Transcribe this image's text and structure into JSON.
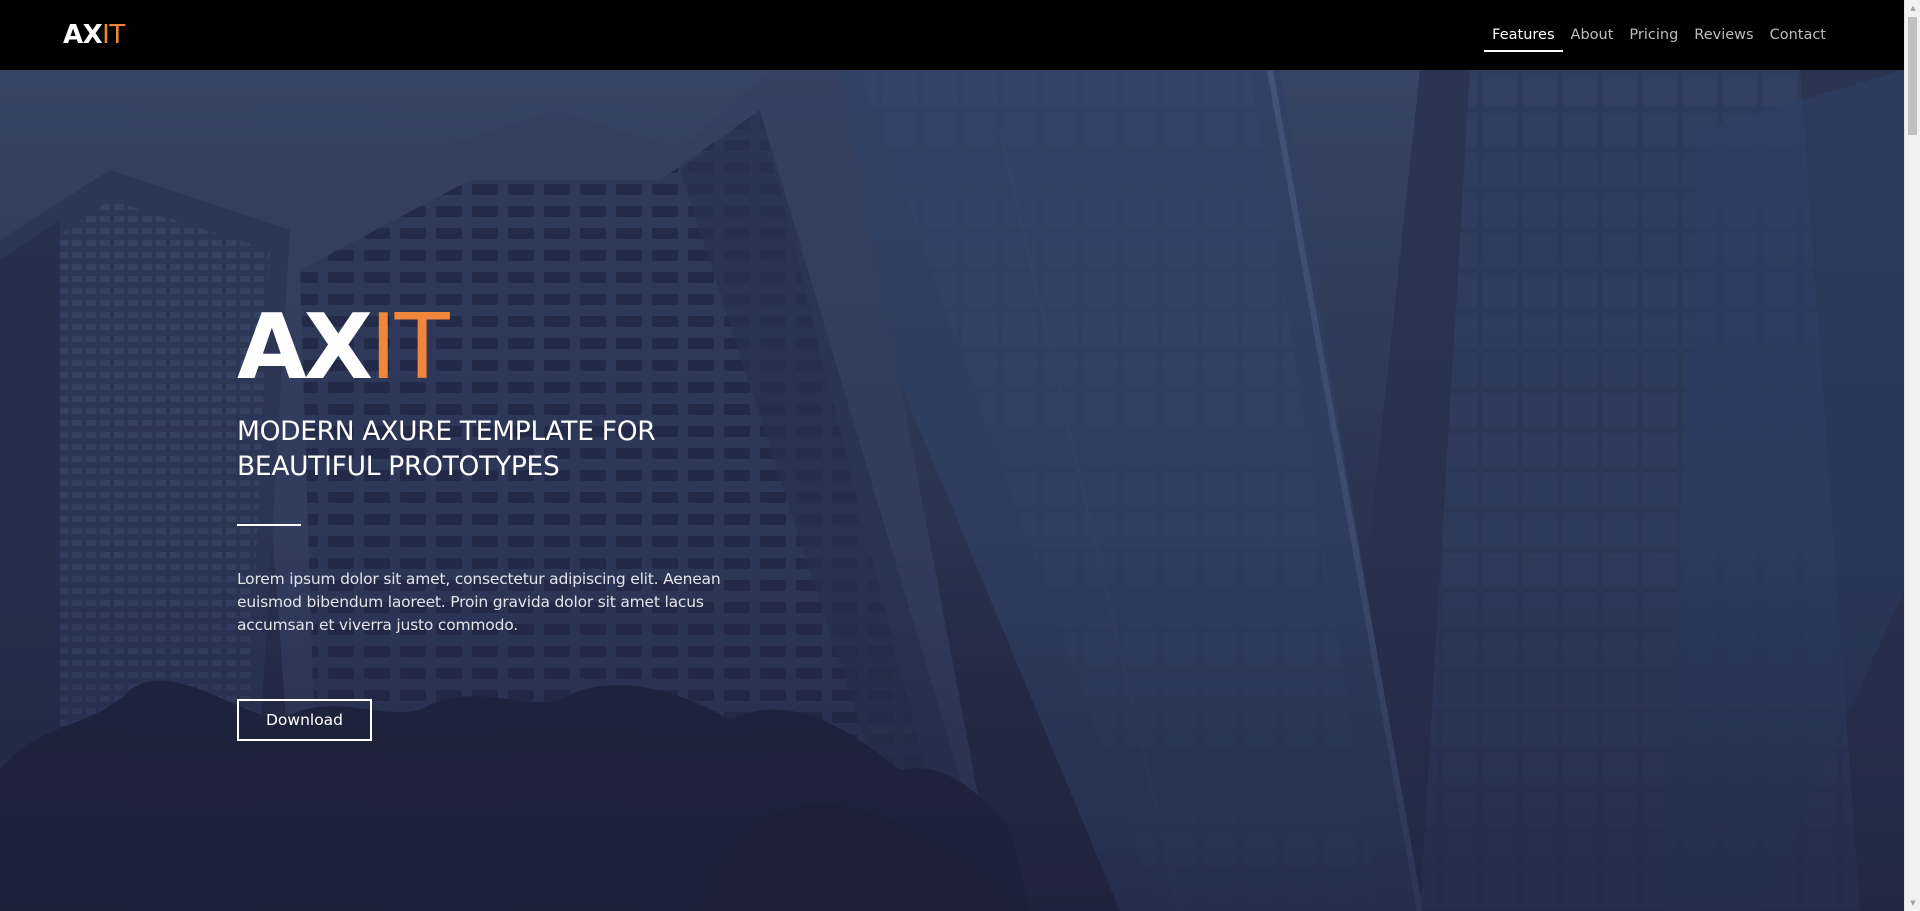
{
  "brand": {
    "logo_main": "AX",
    "logo_accent": "IT"
  },
  "nav": {
    "items": [
      {
        "label": "Features",
        "active": true
      },
      {
        "label": "About",
        "active": false
      },
      {
        "label": "Pricing",
        "active": false
      },
      {
        "label": "Reviews",
        "active": false
      },
      {
        "label": "Contact",
        "active": false
      }
    ]
  },
  "hero": {
    "logo_main": "AX",
    "logo_accent": "IT",
    "heading_line1": "MODERN AXURE TEMPLATE FOR",
    "heading_line2": "BEAUTIFUL PROTOTYPES",
    "body_line1": "Lorem ipsum dolor sit amet, consectetur adipiscing elit. Aenean",
    "body_line2": "euismod bibendum laoreet. Proin gravida dolor sit amet lacus",
    "body_line3": "accumsan et viverra justo commodo.",
    "button_label": "Download"
  },
  "colors": {
    "accent": "#f0863a",
    "navbar_bg": "#000000",
    "hero_overlay": "#2a3252"
  },
  "icons": {
    "scroll_up": "scroll-up-arrow-icon",
    "scroll_down": "scroll-down-arrow-icon"
  }
}
